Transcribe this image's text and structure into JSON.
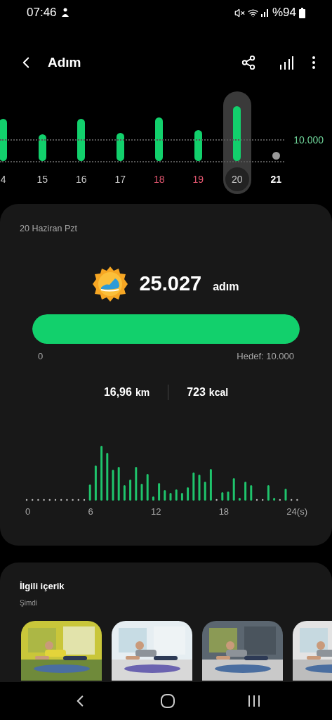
{
  "status_bar": {
    "time": "07:46",
    "battery": "%94"
  },
  "header": {
    "title": "Adım"
  },
  "week_chart": {
    "goal_label": "10.000",
    "days": [
      {
        "label": "4",
        "kind": "weekday",
        "selected": false
      },
      {
        "label": "15",
        "kind": "weekday",
        "selected": false
      },
      {
        "label": "16",
        "kind": "weekday",
        "selected": false
      },
      {
        "label": "17",
        "kind": "weekday",
        "selected": false
      },
      {
        "label": "18",
        "kind": "weekend",
        "selected": false
      },
      {
        "label": "19",
        "kind": "weekend",
        "selected": false
      },
      {
        "label": "20",
        "kind": "weekday",
        "selected": true
      },
      {
        "label": "21",
        "kind": "today",
        "selected": false
      }
    ]
  },
  "summary": {
    "date": "20 Haziran Pzt",
    "steps": "25.027",
    "steps_unit": "adım",
    "progress": {
      "level": 1,
      "start_label": "0",
      "goal_label": "Hedef: 10.000"
    },
    "distance": "16,96",
    "distance_unit": "km",
    "calories": "723",
    "calories_unit": "kcal",
    "hourly_axis": [
      "0",
      "6",
      "12",
      "18",
      "24(s)"
    ]
  },
  "related": {
    "title": "İlgili içerik",
    "subtitle": "Şimdi"
  }
}
